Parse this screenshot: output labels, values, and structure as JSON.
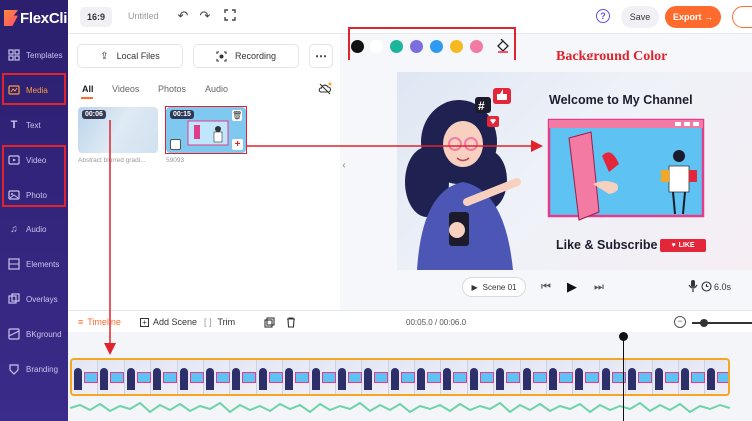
{
  "app": {
    "brand": "FlexClip"
  },
  "topbar": {
    "ratio": "16:9",
    "title": "Untitled",
    "save_label": "Save",
    "export_label": "Export →"
  },
  "sidebar": {
    "items": [
      {
        "label": "Templates",
        "icon": "templates-icon"
      },
      {
        "label": "Media",
        "icon": "media-icon",
        "active": true
      },
      {
        "label": "Text",
        "icon": "text-icon"
      },
      {
        "label": "Video",
        "icon": "video-icon"
      },
      {
        "label": "Photo",
        "icon": "photo-icon"
      },
      {
        "label": "Audio",
        "icon": "audio-icon"
      },
      {
        "label": "Elements",
        "icon": "elements-icon"
      },
      {
        "label": "Overlays",
        "icon": "overlays-icon"
      },
      {
        "label": "BKground",
        "icon": "background-icon"
      },
      {
        "label": "Branding",
        "icon": "branding-icon"
      }
    ]
  },
  "media_panel": {
    "local_files_label": "Local Files",
    "recording_label": "Recording",
    "tabs": [
      "All",
      "Videos",
      "Photos",
      "Audio"
    ],
    "active_tab": "All",
    "items": [
      {
        "duration": "00:06",
        "caption": "Abstract blurred gradi..."
      },
      {
        "duration": "00:15",
        "caption": "59093"
      }
    ]
  },
  "color_toolbar": {
    "colors": [
      "#111111",
      "#ffffff",
      "#1bb59c",
      "#7b6ee0",
      "#2f9bf0",
      "#f5b921",
      "#f27aa3"
    ],
    "annotation": "Background Color"
  },
  "preview": {
    "title": "Welcome to My Channel",
    "subtitle": "Like & Subscribe",
    "like_label": "LIKE",
    "scene_label": "Scene 01",
    "duration": "6.0s"
  },
  "timeline": {
    "label": "Timeline",
    "add_scene_label": "Add Scene",
    "trim_label": "Trim",
    "time_readout": "00:05.0 / 00:06.0"
  },
  "colors": {
    "accent": "#ff6b2c",
    "sidebar": "#2b1f6e",
    "annotation_red": "#e0232c"
  }
}
